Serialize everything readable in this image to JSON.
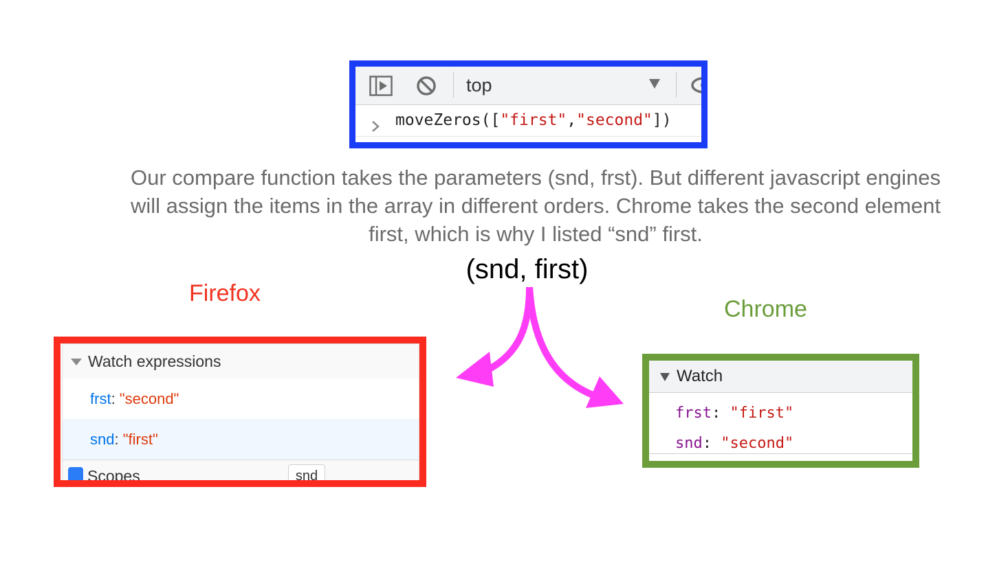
{
  "console": {
    "context": "top",
    "command_name": "moveZeros",
    "open": "([",
    "arg1": "\"first\"",
    "comma": ",",
    "arg2": "\"second\"",
    "close": "])",
    "icons": [
      "sidebar-toggle-icon",
      "clear-console-icon",
      "dropdown-arrow-icon",
      "eye-icon",
      "prompt-chevron-icon"
    ],
    "frame_color": "#1a3cf6"
  },
  "caption": "Our compare function takes the parameters (snd, frst). But different javascript engines will assign the items in the array in different orders. Chrome takes the second element first, which is why I listed “snd” first.",
  "signature": "(snd, first)",
  "firefox": {
    "label": "Firefox",
    "label_color": "#f0321f",
    "frame_color": "#fb2b1f",
    "header": "Watch expressions",
    "rows": [
      {
        "key": "frst",
        "sep": ": ",
        "value": "\"second\""
      },
      {
        "key": "snd",
        "sep": ": ",
        "value": "\"first\""
      }
    ],
    "scopes_label": "Scopes",
    "tag": "snd"
  },
  "chrome": {
    "label": "Chrome",
    "label_color": "#6b9d3b",
    "frame_color": "#6b9d3b",
    "header": "Watch",
    "rows": [
      {
        "key": "frst",
        "sep": ": ",
        "value": "\"first\""
      },
      {
        "key": "snd",
        "sep": ": ",
        "value": "\"second\""
      }
    ]
  },
  "arrow_color": "#ff3df7"
}
